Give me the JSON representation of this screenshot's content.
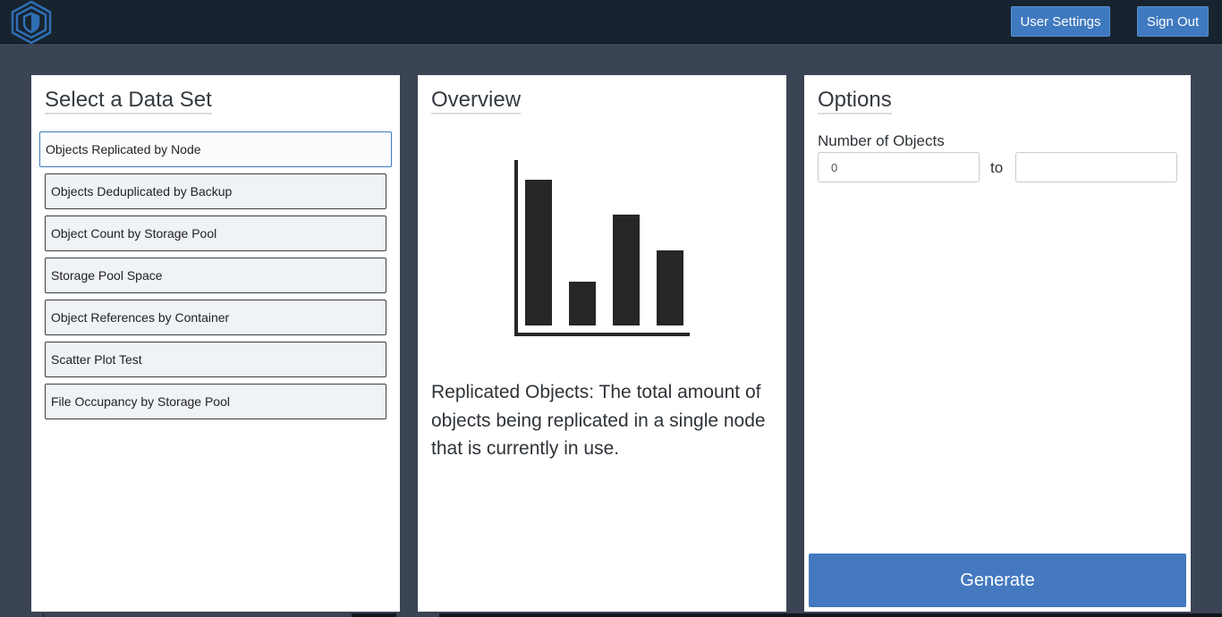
{
  "header": {
    "logo_icon": "shield-hexagon-icon",
    "user_settings_label": "User Settings",
    "sign_out_label": "Sign Out",
    "accent_color": "#3f79bf"
  },
  "datasets": {
    "title": "Select a Data Set",
    "selected_index": 0,
    "items": [
      {
        "label": "Objects Replicated by Node"
      },
      {
        "label": "Objects Deduplicated by Backup"
      },
      {
        "label": "Object Count by Storage Pool"
      },
      {
        "label": "Storage Pool Space"
      },
      {
        "label": "Object References by Container"
      },
      {
        "label": "Scatter Plot Test"
      },
      {
        "label": "File Occupancy by Storage Pool"
      }
    ]
  },
  "overview": {
    "title": "Overview",
    "chart_icon": "bar-chart-icon",
    "description": "Replicated Objects: The total amount of objects being replicated in a single node that is currently in use."
  },
  "options": {
    "title": "Options",
    "number_label": "Number of Objects",
    "min_value": "0",
    "max_value": "",
    "to_label": "to",
    "generate_label": "Generate"
  }
}
